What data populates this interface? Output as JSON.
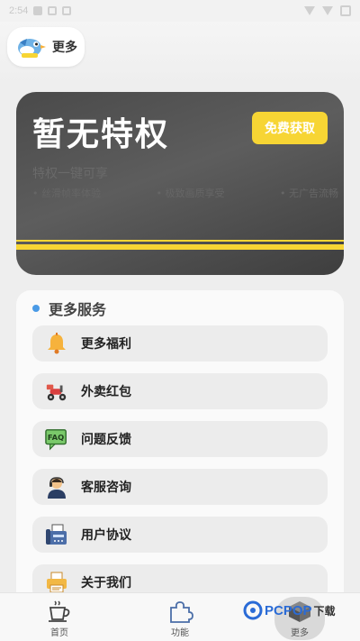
{
  "status": {
    "time": "2:54"
  },
  "header": {
    "title": "更多"
  },
  "vip": {
    "title": "暂无特权",
    "free_button": "免费获取",
    "subtitle": "特权一键可享",
    "features": [
      "• 丝滑帧率体验",
      "• 极致画质享受",
      "• 无广告流畅"
    ]
  },
  "services": {
    "heading": "更多服务",
    "items": [
      {
        "label": "更多福利",
        "icon": "bell-icon"
      },
      {
        "label": "外卖红包",
        "icon": "scooter-icon"
      },
      {
        "label": "问题反馈",
        "icon": "faq-icon"
      },
      {
        "label": "客服咨询",
        "icon": "support-agent-icon"
      },
      {
        "label": "用户协议",
        "icon": "fax-icon"
      },
      {
        "label": "关于我们",
        "icon": "printer-icon"
      }
    ]
  },
  "tabs": [
    {
      "label": "首页",
      "icon": "coffee-cup-icon"
    },
    {
      "label": "功能",
      "icon": "puzzle-icon"
    },
    {
      "label": "更多",
      "icon": "cube-icon"
    }
  ],
  "watermark": {
    "brand": "PCPOP",
    "suffix": "下载"
  },
  "colors": {
    "accent_yellow": "#f7d534",
    "card_dark": "#4a4a4a",
    "dot_blue": "#4a9ae6"
  }
}
